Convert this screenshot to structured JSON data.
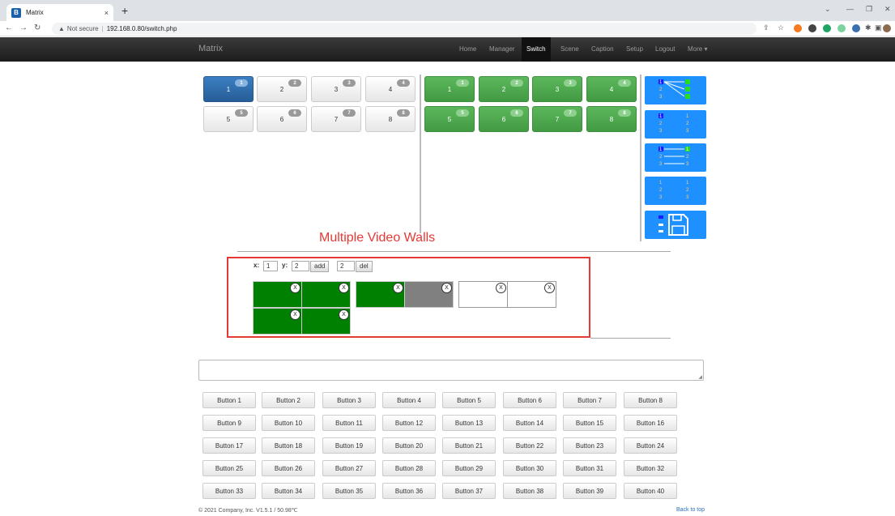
{
  "browser": {
    "tab_title": "Matrix",
    "tab_close": "×",
    "new_tab": "+",
    "security": "Not secure",
    "url": "192.168.0.80/switch.php"
  },
  "navbar": {
    "brand": "Matrix",
    "items": [
      "Home",
      "Manager",
      "Switch",
      "Scene",
      "Caption",
      "Setup",
      "Logout",
      "More ▾"
    ],
    "active": "Switch"
  },
  "inputs": [
    {
      "label": "1",
      "badge": "1",
      "selected": true
    },
    {
      "label": "2",
      "badge": "2"
    },
    {
      "label": "3",
      "badge": "3"
    },
    {
      "label": "4",
      "badge": "4"
    },
    {
      "label": "5",
      "badge": "5"
    },
    {
      "label": "6",
      "badge": "6"
    },
    {
      "label": "7",
      "badge": "7"
    },
    {
      "label": "8",
      "badge": "8"
    }
  ],
  "outputs": [
    {
      "label": "1",
      "badge": "1"
    },
    {
      "label": "2",
      "badge": "2"
    },
    {
      "label": "3",
      "badge": "3"
    },
    {
      "label": "4",
      "badge": "4"
    },
    {
      "label": "5",
      "badge": "5"
    },
    {
      "label": "6",
      "badge": "6"
    },
    {
      "label": "7",
      "badge": "7"
    },
    {
      "label": "8",
      "badge": "8"
    }
  ],
  "annotation": "Multiple Video Walls",
  "wall": {
    "x_label": "x:",
    "x_value": "1",
    "y_label": "y:",
    "y_value": "2",
    "add_label": "add",
    "del_value": "2",
    "del_label": "del",
    "close_glyph": "X",
    "cell_tag": "0"
  },
  "buttons": [
    "Button 1",
    "Button 2",
    "Button 3",
    "Button 4",
    "Button 5",
    "Button 6",
    "Button 7",
    "Button 8",
    "Button 9",
    "Button 10",
    "Button 11",
    "Button 12",
    "Button 13",
    "Button 14",
    "Button 15",
    "Button 16",
    "Button 17",
    "Button 18",
    "Button 19",
    "Button 20",
    "Button 21",
    "Button 22",
    "Button 23",
    "Button 24",
    "Button 25",
    "Button 26",
    "Button 27",
    "Button 28",
    "Button 29",
    "Button 30",
    "Button 31",
    "Button 32",
    "Button 33",
    "Button 34",
    "Button 35",
    "Button 36",
    "Button 37",
    "Button 38",
    "Button 39",
    "Button 40"
  ],
  "footer": {
    "copyright": "© 2021 Company, Inc. V1.5.1 / 50.98℃",
    "back_to_top": "Back to top"
  },
  "colors": {
    "selected_input": "#2f6fae",
    "output_green": "#4cae4c",
    "mode_blue": "#1e90ff",
    "annotation_red": "#e53935",
    "wall_green": "#008000",
    "wall_gray": "#808080"
  }
}
